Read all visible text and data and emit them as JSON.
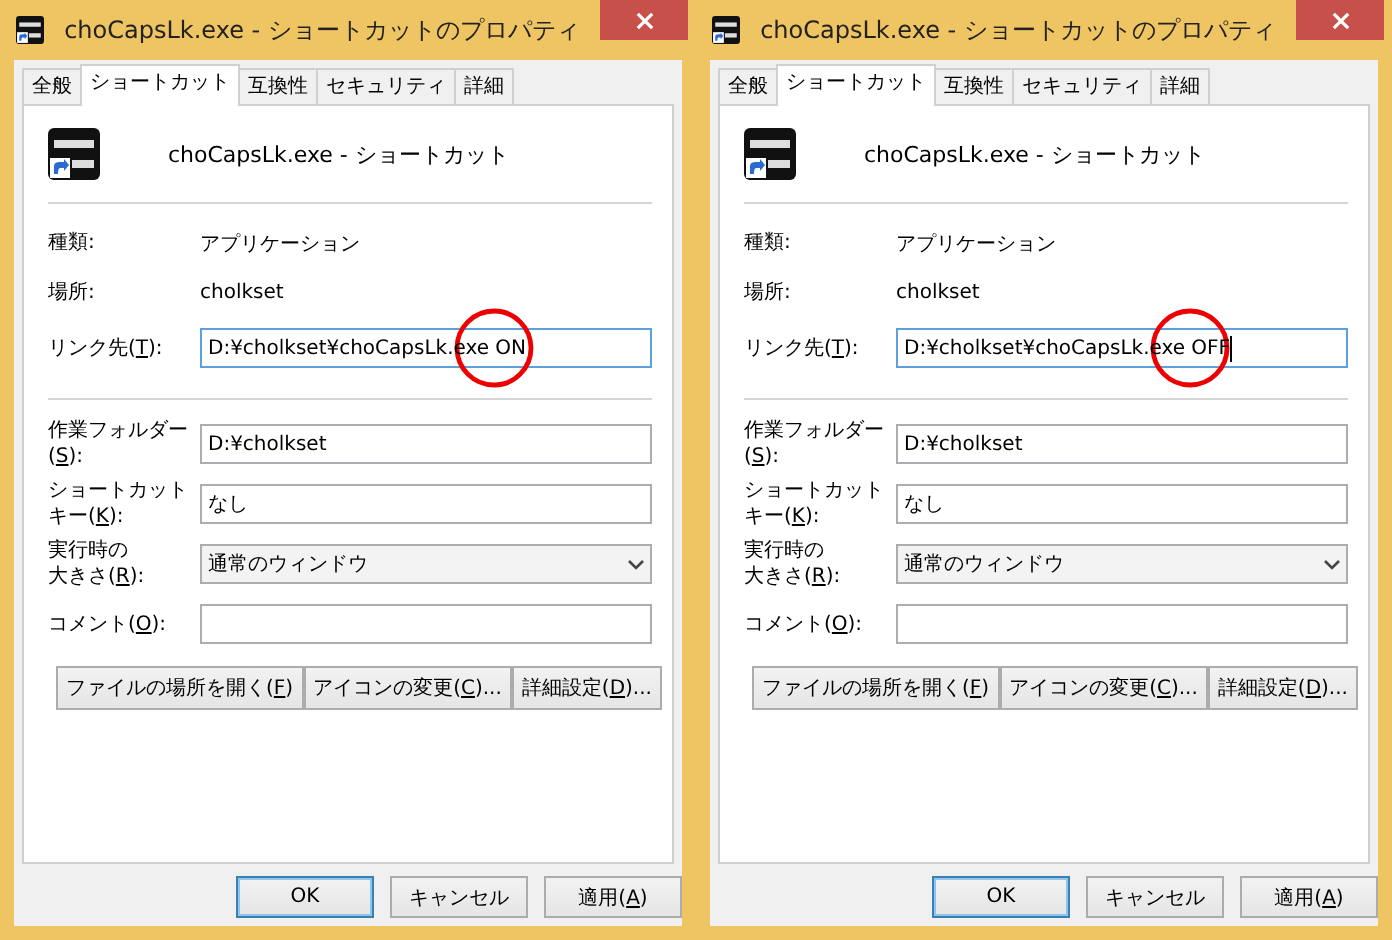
{
  "windows": [
    {
      "title": "choCapsLk.exe - ショートカットのプロパティ",
      "tabs": [
        {
          "label": "全般",
          "selected": false
        },
        {
          "label": "ショートカット",
          "selected": true
        },
        {
          "label": "互換性",
          "selected": false
        },
        {
          "label": "セキュリティ",
          "selected": false
        },
        {
          "label": "詳細",
          "selected": false
        }
      ],
      "header_name": "choCapsLk.exe - ショートカット",
      "info": [
        {
          "label": "種類:",
          "value": "アプリケーション"
        },
        {
          "label": "場所:",
          "value": "cholkset"
        }
      ],
      "target": {
        "label": [
          {
            "pre": "リンク先(",
            "key": "T",
            "post": "):"
          }
        ],
        "value": "D:¥cholkset¥choCapsLk.exe ON",
        "focused": true,
        "caret": false,
        "circled": true
      },
      "fields": [
        {
          "kind": "text",
          "label": [
            {
              "pre": "作業フォルダー"
            },
            {
              "pre": "(",
              "key": "S",
              "post": "):"
            }
          ],
          "value": "D:¥cholkset"
        },
        {
          "kind": "text",
          "label": [
            {
              "pre": "ショートカット"
            },
            {
              "pre": "キー(",
              "key": "K",
              "post": "):"
            }
          ],
          "value": "なし"
        },
        {
          "kind": "select",
          "label": [
            {
              "pre": "実行時の"
            },
            {
              "pre": "大きさ(",
              "key": "R",
              "post": "):"
            }
          ],
          "value": "通常のウィンドウ"
        },
        {
          "kind": "text",
          "label": [
            {
              "pre": "コメント(",
              "key": "O",
              "post": "):"
            }
          ]
        }
      ],
      "actions": [
        {
          "pre": "ファイルの場所を開く(",
          "key": "F",
          "post": ")"
        },
        {
          "pre": "アイコンの変更(",
          "key": "C",
          "post": ")..."
        },
        {
          "pre": "詳細設定(",
          "key": "D",
          "post": ")..."
        }
      ],
      "buttons": [
        {
          "pre": "OK",
          "default": true
        },
        {
          "pre": "キャンセル",
          "default": false
        },
        {
          "pre": "適用(",
          "key": "A",
          "post": ")",
          "default": false
        }
      ]
    },
    {
      "title": "choCapsLk.exe - ショートカットのプロパティ",
      "tabs": [
        {
          "label": "全般",
          "selected": false
        },
        {
          "label": "ショートカット",
          "selected": true
        },
        {
          "label": "互換性",
          "selected": false
        },
        {
          "label": "セキュリティ",
          "selected": false
        },
        {
          "label": "詳細",
          "selected": false
        }
      ],
      "header_name": "choCapsLk.exe - ショートカット",
      "info": [
        {
          "label": "種類:",
          "value": "アプリケーション"
        },
        {
          "label": "場所:",
          "value": "cholkset"
        }
      ],
      "target": {
        "label": [
          {
            "pre": "リンク先(",
            "key": "T",
            "post": "):"
          }
        ],
        "value": "D:¥cholkset¥choCapsLk.exe OFF",
        "focused": true,
        "caret": true,
        "circled": true
      },
      "fields": [
        {
          "kind": "text",
          "label": [
            {
              "pre": "作業フォルダー"
            },
            {
              "pre": "(",
              "key": "S",
              "post": "):"
            }
          ],
          "value": "D:¥cholkset"
        },
        {
          "kind": "text",
          "label": [
            {
              "pre": "ショートカット"
            },
            {
              "pre": "キー(",
              "key": "K",
              "post": "):"
            }
          ],
          "value": "なし"
        },
        {
          "kind": "select",
          "label": [
            {
              "pre": "実行時の"
            },
            {
              "pre": "大きさ(",
              "key": "R",
              "post": "):"
            }
          ],
          "value": "通常のウィンドウ"
        },
        {
          "kind": "text",
          "label": [
            {
              "pre": "コメント(",
              "key": "O",
              "post": "):"
            }
          ]
        }
      ],
      "actions": [
        {
          "pre": "ファイルの場所を開く(",
          "key": "F",
          "post": ")"
        },
        {
          "pre": "アイコンの変更(",
          "key": "C",
          "post": ")..."
        },
        {
          "pre": "詳細設定(",
          "key": "D",
          "post": ")..."
        }
      ],
      "buttons": [
        {
          "pre": "OK",
          "default": true
        },
        {
          "pre": "キャンセル",
          "default": false
        },
        {
          "pre": "適用(",
          "key": "A",
          "post": ")",
          "default": false
        }
      ]
    }
  ]
}
